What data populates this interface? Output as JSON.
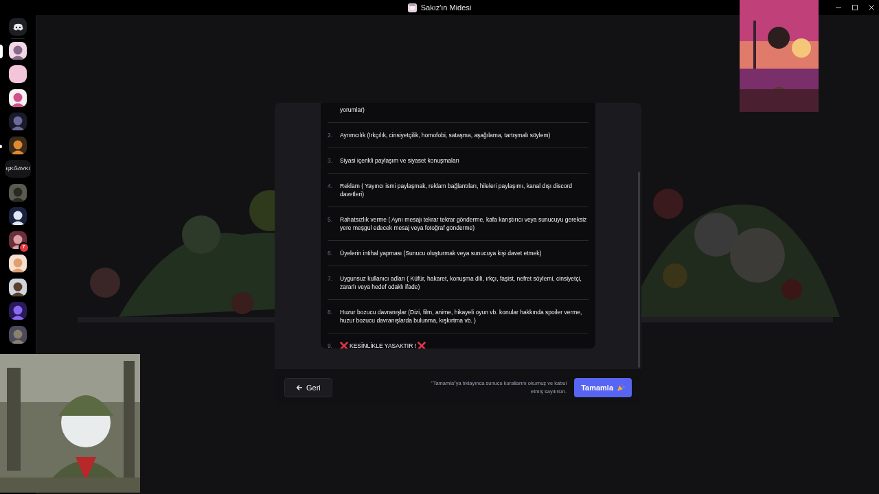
{
  "window": {
    "title": "Sakız'ın Midesi"
  },
  "servers": [
    {
      "kind": "home",
      "selected": false,
      "unread": false
    },
    {
      "kind": "picture",
      "selected": true,
      "unread": false
    },
    {
      "kind": "blank",
      "selected": false,
      "unread": false
    },
    {
      "kind": "picture",
      "selected": false,
      "unread": false
    },
    {
      "kind": "picture",
      "selected": false,
      "unread": false
    },
    {
      "kind": "picture",
      "selected": false,
      "unread": true
    },
    {
      "kind": "acronym",
      "acronym": "ışKĞAVKI",
      "selected": false,
      "unread": false
    },
    {
      "kind": "picture",
      "selected": false,
      "unread": false
    },
    {
      "kind": "picture",
      "selected": false,
      "unread": false
    },
    {
      "kind": "picture",
      "selected": false,
      "unread": false,
      "badge": "7"
    },
    {
      "kind": "picture",
      "selected": false,
      "unread": false
    },
    {
      "kind": "picture",
      "selected": false,
      "unread": false
    },
    {
      "kind": "picture",
      "selected": false,
      "unread": false
    },
    {
      "kind": "picture",
      "selected": false,
      "unread": false
    }
  ],
  "rules": [
    {
      "kind": "plain",
      "text": "yorumlar)"
    },
    {
      "kind": "plain",
      "number": "2.",
      "text": "Ayrımcılık (Irkçılık, cinsiyetçilik, homofobi, sataşma, aşağılama, tartışmalı söylem)"
    },
    {
      "kind": "plain",
      "number": "3.",
      "text": "Siyasi içerikli paylaşım ve siyaset konuşmaları"
    },
    {
      "kind": "plain",
      "number": "4.",
      "text": "Reklam ( Yayıncı ismi paylaşmak, reklam bağlantıları, hileleri paylaşımı, kanal dışı discord davetleri)"
    },
    {
      "kind": "plain",
      "number": "5.",
      "text": "Rahatsızlık verme ( Aynı mesajı tekrar tekrar gönderme, kafa karıştırıcı veya sunucuyu gereksiz yere meşgul edecek mesaj veya fotoğraf gönderme)"
    },
    {
      "kind": "plain",
      "number": "6.",
      "text": "Üyelerin intihal yapması (Sunucu oluşturmak veya sunucuya kişi davet etmek)"
    },
    {
      "kind": "plain",
      "number": "7.",
      "text": "Uygunsuz kullanıcı adları ( Küfür, hakaret, konuşma dili, ırkçı, faşist, nefret söylemi, cinsiyetçi, zararlı veya hedef odaklı ifade)"
    },
    {
      "kind": "plain",
      "number": "8.",
      "text": "Huzur bozucu davranışlar (Dizi, film, anime, hikayeli oyun vb. konular hakkında spoiler verme, huzur bozucu davranışlarda bulunma, kışkırtma vb. )"
    },
    {
      "kind": "crossed",
      "number": "9.",
      "text": "KESİNLİKLE YASAKTIR !"
    }
  ],
  "footer": {
    "back_button": "Geri",
    "note": "\"Tamamla\"ya tıklayınca sunucu kurallarını okumuş ve kabul etmiş sayılırsın.",
    "finish_button": "Tamamla"
  }
}
